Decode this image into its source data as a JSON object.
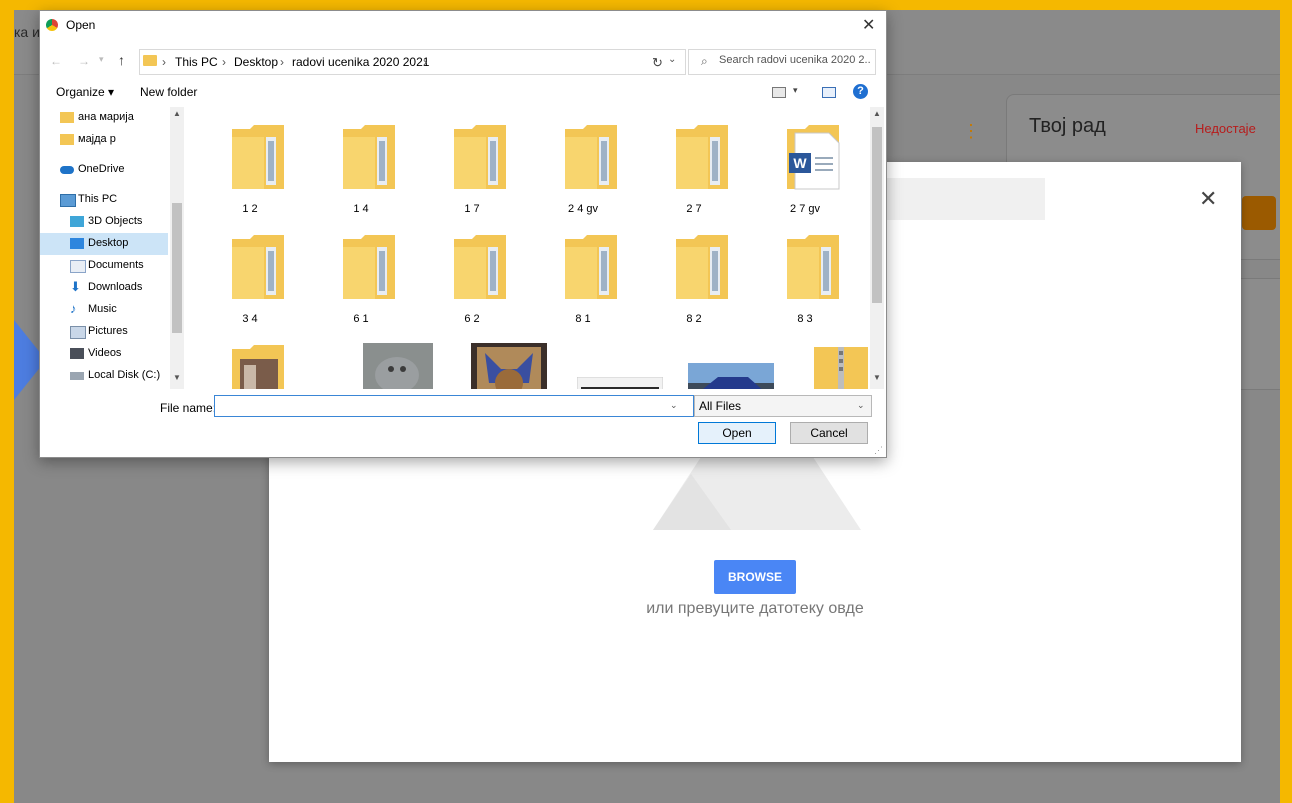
{
  "background": {
    "partial_title": "ка и",
    "work_card": {
      "title": "Твој рад",
      "status": "Недостаје"
    }
  },
  "picker": {
    "browse_label": "BROWSE",
    "drop_text": "или превуците датотеку овде"
  },
  "dialog": {
    "title": "Open",
    "breadcrumbs": [
      "This PC",
      "Desktop",
      "radovi ucenika 2020 2021"
    ],
    "search_placeholder": "Search radovi ucenika 2020 2...",
    "toolbar": {
      "organize": "Organize ▾",
      "new_folder": "New folder"
    },
    "nav_items": [
      {
        "label": "ана марија",
        "icon": "folder-icon"
      },
      {
        "label": "мајда р",
        "icon": "folder-icon"
      },
      {
        "label": "OneDrive",
        "icon": "cloud-icon"
      },
      {
        "label": "This PC",
        "icon": "computer-icon"
      },
      {
        "label": "3D Objects",
        "icon": "cube-icon"
      },
      {
        "label": "Desktop",
        "icon": "desktop-icon"
      },
      {
        "label": "Documents",
        "icon": "document-icon"
      },
      {
        "label": "Downloads",
        "icon": "download-icon"
      },
      {
        "label": "Music",
        "icon": "music-icon"
      },
      {
        "label": "Pictures",
        "icon": "pictures-icon"
      },
      {
        "label": "Videos",
        "icon": "video-icon"
      },
      {
        "label": "Local Disk (C:)",
        "icon": "disk-icon"
      }
    ],
    "files": [
      {
        "name": "1 2",
        "type": "folder"
      },
      {
        "name": "1 4",
        "type": "folder"
      },
      {
        "name": "1 7",
        "type": "folder"
      },
      {
        "name": "2 4 gv",
        "type": "folder"
      },
      {
        "name": "2 7",
        "type": "folder"
      },
      {
        "name": "2 7 gv",
        "type": "word-document"
      },
      {
        "name": "3 4",
        "type": "folder"
      },
      {
        "name": "6 1",
        "type": "folder"
      },
      {
        "name": "6 2",
        "type": "folder"
      },
      {
        "name": "8 1",
        "type": "folder"
      },
      {
        "name": "8 2",
        "type": "folder"
      },
      {
        "name": "8 3",
        "type": "folder"
      }
    ],
    "file_name_label": "File name:",
    "file_name_value": "",
    "filter": "All Files",
    "open_label": "Open",
    "cancel_label": "Cancel"
  },
  "colors": {
    "frame": "#f5b800",
    "overlay": "#888888",
    "accent": "#4a86f5",
    "folder": "#f3c655",
    "selected": "#cce4f7",
    "status_missing": "#b71c1c"
  }
}
